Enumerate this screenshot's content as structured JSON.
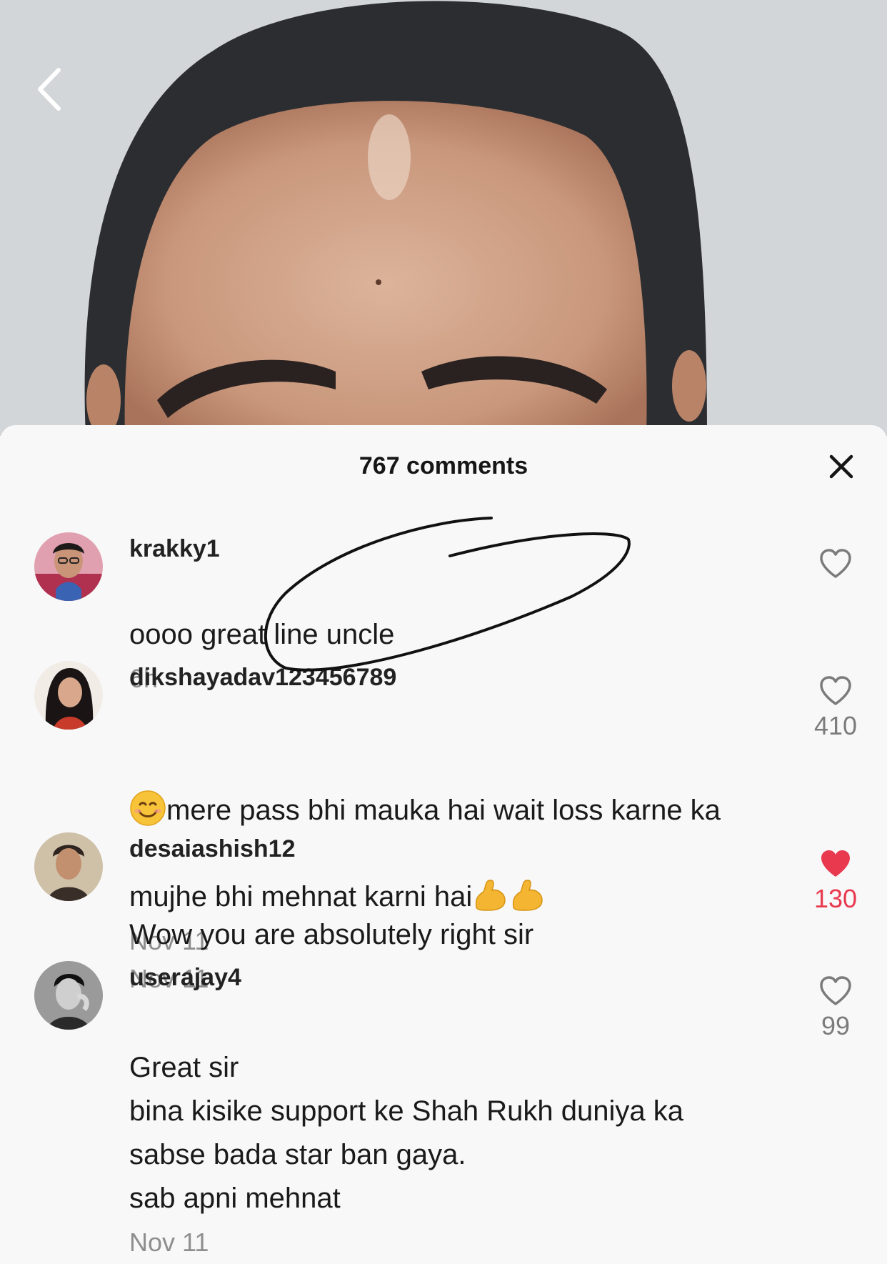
{
  "video": {
    "back_icon": "chevron-left-icon"
  },
  "comments_sheet": {
    "title": "767 comments",
    "close_icon": "close-icon",
    "like_color": "#e8394f",
    "comments": [
      {
        "username": "krakky1",
        "text": "oooo great line uncle",
        "time": "6h",
        "like_count": "",
        "liked": false
      },
      {
        "username": "dikshayadav123456789",
        "text_parts": [
          "mere pass bhi mauka hai wait loss karne ka\nmujhe bhi mehnat karni hai"
        ],
        "emoji_lead": "smiling-face-icon",
        "emoji_trail": "flexed-biceps-icon",
        "time": "Nov 11",
        "like_count": "410",
        "liked": false
      },
      {
        "username": "desaiashish12",
        "text": "Wow you are absolutely right sir",
        "time": "Nov 11",
        "like_count": "130",
        "liked": true
      },
      {
        "username": "userajay4",
        "text": "Great sir\nbina kisike support ke Shah Rukh duniya ka\nsabse bada star ban gaya.\nsab apni mehnat",
        "time": "Nov 11",
        "like_count": "99",
        "liked": false
      }
    ]
  }
}
